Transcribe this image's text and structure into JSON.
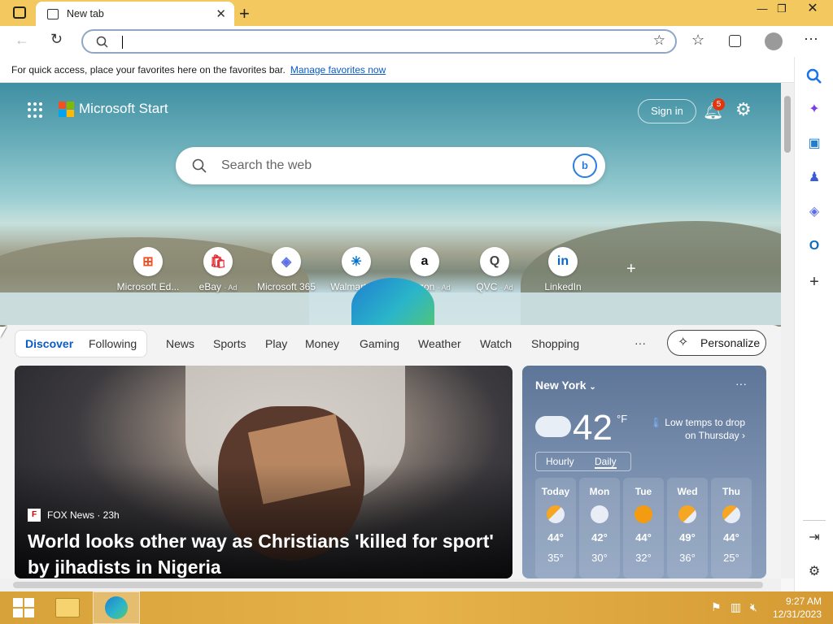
{
  "tab": {
    "title": "New tab"
  },
  "window_controls": {
    "minimize": "—",
    "restore": "❐",
    "close": "✕"
  },
  "favbar": {
    "message": "For quick access, place your favorites here on the favorites bar.",
    "link": "Manage favorites now"
  },
  "newtab": {
    "brand": "Microsoft Start",
    "sign_in": "Sign in",
    "notification_count": "5",
    "search_placeholder": "Search the web",
    "quick_links": [
      {
        "name": "Microsoft Ed...",
        "ad": "",
        "glyph": "⊞"
      },
      {
        "name": "eBay",
        "ad": "· Ad",
        "glyph": "🛍"
      },
      {
        "name": "Microsoft 365",
        "ad": "",
        "glyph": "◈"
      },
      {
        "name": "Walmart",
        "ad": "· Ad",
        "glyph": "✳"
      },
      {
        "name": "Amazon",
        "ad": "· Ad",
        "glyph": "a"
      },
      {
        "name": "QVC",
        "ad": "· Ad",
        "glyph": "Q"
      },
      {
        "name": "LinkedIn",
        "ad": "",
        "glyph": "in"
      }
    ],
    "add_link": "+"
  },
  "feed_nav": {
    "discover": "Discover",
    "following": "Following",
    "categories": [
      "News",
      "Sports",
      "Play",
      "Money",
      "Gaming",
      "Weather",
      "Watch",
      "Shopping"
    ],
    "more": "···",
    "personalize": "Personalize"
  },
  "news": {
    "source": "FOX News · 23h",
    "headline": "World looks other way as Christians 'killed for sport' by jihadists in Nigeria"
  },
  "weather": {
    "city": "New York",
    "temp": "42",
    "unit": "°F",
    "alert": "Low temps to drop on Thursday",
    "toggle": [
      "Hourly",
      "Daily"
    ],
    "days": [
      {
        "name": "Today",
        "hi": "44°",
        "lo": "35°",
        "icon": "partly-cloudy"
      },
      {
        "name": "Mon",
        "hi": "42°",
        "lo": "30°",
        "icon": "cloudy"
      },
      {
        "name": "Tue",
        "hi": "44°",
        "lo": "32°",
        "icon": "sunny"
      },
      {
        "name": "Wed",
        "hi": "49°",
        "lo": "36°",
        "icon": "partly-sunny"
      },
      {
        "name": "Thu",
        "hi": "44°",
        "lo": "25°",
        "icon": "partly-cloudy"
      }
    ]
  },
  "taskbar": {
    "time": "9:27 AM",
    "date": "12/31/2023"
  },
  "colors": {
    "titlebar": "#f3c95f",
    "accent": "#0b5bc4",
    "taskbar": "#e0a942"
  }
}
